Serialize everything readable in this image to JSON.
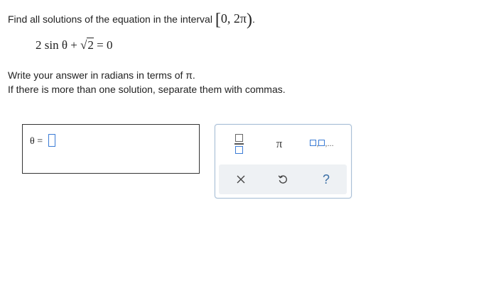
{
  "prompt": {
    "text": "Find all solutions of the equation in the interval",
    "interval_open": "[",
    "interval_body": "0, 2π",
    "interval_close": ")",
    "period": "."
  },
  "equation": {
    "left": "2 sin θ + ",
    "sqrt_symbol": "√",
    "sqrt_arg": "2",
    "right": " = 0"
  },
  "instructions": {
    "line1": "Write your answer in radians in terms of π.",
    "line2": "If there is more than one solution, separate them with commas."
  },
  "answer": {
    "variable": "θ",
    "equals": "=",
    "value": ""
  },
  "toolbox": {
    "pi_label": "π",
    "list_sep": ",",
    "list_ellipsis": ",...",
    "help_label": "?",
    "icons": {
      "fraction": "fraction-icon",
      "pi": "pi-icon",
      "list": "list-icon",
      "clear": "close-icon",
      "undo": "undo-icon",
      "help": "help-icon"
    },
    "colors": {
      "accent": "#3a7bd5",
      "border": "#a9bfd6",
      "action_bg": "#eef1f4",
      "help": "#3a6ea5"
    }
  }
}
